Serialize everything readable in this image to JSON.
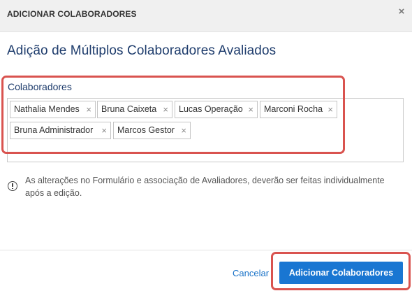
{
  "modal": {
    "header_title": "ADICIONAR COLABORADORES",
    "close_glyph": "×",
    "close_icon": "close-icon"
  },
  "main": {
    "title": "Adição de Múltiplos Colaboradores Avaliados",
    "field_label": "Colaboradores",
    "tags": [
      {
        "label": "Nathalia Mendes"
      },
      {
        "label": "Bruna Caixeta"
      },
      {
        "label": "Lucas Operação"
      },
      {
        "label": "Marconi Rocha"
      },
      {
        "label": "Bruna Administrador"
      },
      {
        "label": "Marcos Gestor"
      }
    ],
    "tag_remove_glyph": "×",
    "info_icon": "info-circle-icon",
    "info_text": "As alterações no Formulário e associação de Avaliadores, deverão ser feitas individualmente após a edição."
  },
  "footer": {
    "cancel_label": "Cancelar",
    "submit_label": "Adicionar Colaboradores"
  },
  "colors": {
    "primary_button": "#1976d2",
    "title_blue": "#1f3d6d",
    "highlight_red": "#d9534f",
    "link_blue": "#1a73c8"
  }
}
